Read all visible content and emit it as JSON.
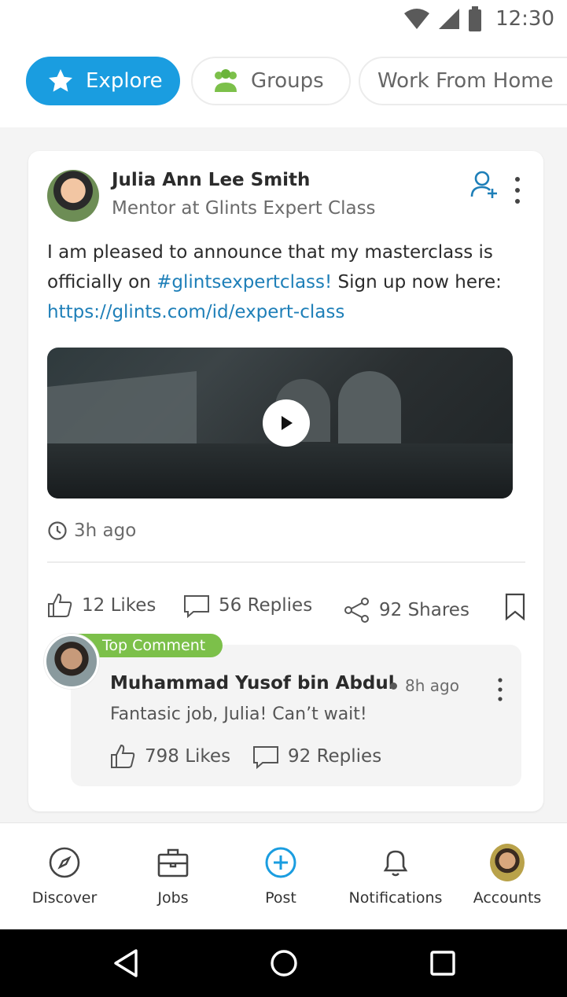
{
  "status": {
    "time": "12:30"
  },
  "chips": [
    {
      "label": "Explore",
      "icon": "star-icon",
      "active": true
    },
    {
      "label": "Groups",
      "icon": "group-icon",
      "active": false
    },
    {
      "label": "Work From Home",
      "active": false
    }
  ],
  "post": {
    "author_name": "Julia Ann Lee Smith",
    "author_role": "Mentor at Glints Expert Class",
    "text_before": "I am pleased to announce that my masterclass is officially on ",
    "hashtag": "#glintsexpertclass!",
    "text_after": " Sign up now here:",
    "link": "https://glints.com/id/expert-class",
    "time": "3h ago",
    "likes": "12 Likes",
    "replies": "56 Replies",
    "shares": "92 Shares"
  },
  "comment": {
    "badge": "Top Comment",
    "author": "Muhammad Yusof bin Abdul",
    "time": "8h ago",
    "text": "Fantasic job, Julia! Can’t wait!",
    "likes": "798 Likes",
    "replies": "92 Replies"
  },
  "nav": {
    "discover": "Discover",
    "jobs": "Jobs",
    "post": "Post",
    "notifications": "Notifications",
    "accounts": "Accounts"
  },
  "colors": {
    "accent": "#1a9de0",
    "link": "#1e7fb8",
    "badge": "#7cc04a"
  }
}
